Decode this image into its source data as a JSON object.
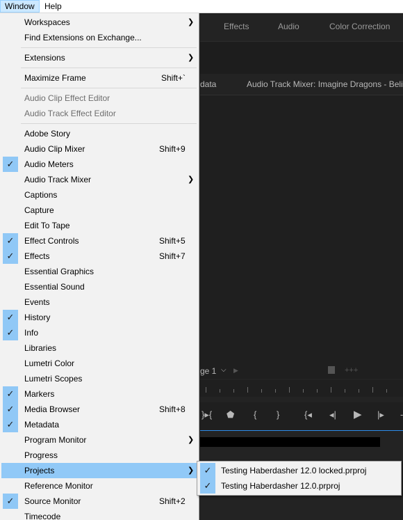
{
  "menubar": {
    "window": "Window",
    "help": "Help"
  },
  "workspaces": {
    "effects": "Effects",
    "audio": "Audio",
    "color": "Color Correction"
  },
  "panel": {
    "metadata_fragment": "data",
    "audio_track_mixer": "Audio Track Mixer: Imagine Dragons - Believer"
  },
  "page_select": {
    "value": "ge 1"
  },
  "menu": {
    "workspaces": "Workspaces",
    "find_extensions": "Find Extensions on Exchange...",
    "extensions": "Extensions",
    "maximize_frame": "Maximize Frame",
    "maximize_frame_sc": "Shift+`",
    "audio_clip_effect_editor": "Audio Clip Effect Editor",
    "audio_track_effect_editor": "Audio Track Effect Editor",
    "adobe_story": "Adobe Story",
    "audio_clip_mixer": "Audio Clip Mixer",
    "audio_clip_mixer_sc": "Shift+9",
    "audio_meters": "Audio Meters",
    "audio_track_mixer": "Audio Track Mixer",
    "captions": "Captions",
    "capture": "Capture",
    "edit_to_tape": "Edit To Tape",
    "effect_controls": "Effect Controls",
    "effect_controls_sc": "Shift+5",
    "effects": "Effects",
    "effects_sc": "Shift+7",
    "essential_graphics": "Essential Graphics",
    "essential_sound": "Essential Sound",
    "events": "Events",
    "history": "History",
    "info": "Info",
    "libraries": "Libraries",
    "lumetri_color": "Lumetri Color",
    "lumetri_scopes": "Lumetri Scopes",
    "markers": "Markers",
    "media_browser": "Media Browser",
    "media_browser_sc": "Shift+8",
    "metadata": "Metadata",
    "program_monitor": "Program Monitor",
    "progress": "Progress",
    "projects": "Projects",
    "reference_monitor": "Reference Monitor",
    "source_monitor": "Source Monitor",
    "source_monitor_sc": "Shift+2",
    "timecode": "Timecode"
  },
  "submenu": {
    "project_locked": "Testing Haberdasher 12.0 locked.prproj",
    "project": "Testing Haberdasher 12.0.prproj"
  },
  "colors": {
    "highlight": "#91c9f7",
    "check_bg": "#90c8f6",
    "menu_bg": "#f2f2f2",
    "app_bg": "#232323"
  }
}
